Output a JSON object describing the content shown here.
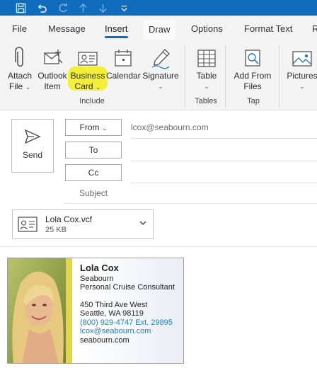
{
  "titlebar": {
    "color": "#0f6cbd",
    "icons": [
      "save-icon",
      "undo-icon",
      "redo-icon",
      "up-arrow-icon",
      "down-arrow-icon",
      "customize-qat-icon"
    ]
  },
  "tabs": [
    {
      "label": "File"
    },
    {
      "label": "Message"
    },
    {
      "label": "Insert",
      "active": true
    },
    {
      "label": "Draw"
    },
    {
      "label": "Options"
    },
    {
      "label": "Format Text"
    },
    {
      "label": "R"
    }
  ],
  "ribbon": {
    "buttons": {
      "attach_file": {
        "line1": "Attach",
        "line2": "File",
        "chevron": "⌄"
      },
      "outlook_item": {
        "line1": "Outlook",
        "line2": "Item"
      },
      "business_card": {
        "line1": "Business",
        "line2": "Card",
        "chevron": "⌄"
      },
      "calendar": {
        "line1": "Calendar"
      },
      "signature": {
        "line1": "Signature",
        "chevron": "⌄"
      },
      "table": {
        "line1": "Table",
        "chevron": "⌄"
      },
      "add_from_files": {
        "line1": "Add From",
        "line2": "Files"
      },
      "pictures": {
        "line1": "Pictures",
        "chevron": "⌄"
      }
    },
    "groups": {
      "include": "Include",
      "tables": "Tables",
      "tap": "Tap"
    },
    "highlight_color": "#f2ee2e"
  },
  "compose": {
    "send_label": "Send",
    "from_label": "From",
    "from_chevron": "⌄",
    "from_value": "lcox@seabourn.com",
    "to_label": "To",
    "cc_label": "Cc",
    "subject_label": "Subject"
  },
  "attachment": {
    "name": "Lola Cox.vcf",
    "size": "25 KB",
    "icon": "contact-card-icon"
  },
  "business_card": {
    "name": "Lola Cox",
    "company": "Seabourn",
    "title": "Personal Cruise Consultant",
    "address1": "450 Third Ave West",
    "address2": "Seattle, WA 98119",
    "phone": "(800) 929-4747 Ext. 29895",
    "email": "lcox@seabourn.com",
    "website": "seabourn.com",
    "accent_color": "#e3d44b",
    "link_color": "#2a7ab8"
  }
}
